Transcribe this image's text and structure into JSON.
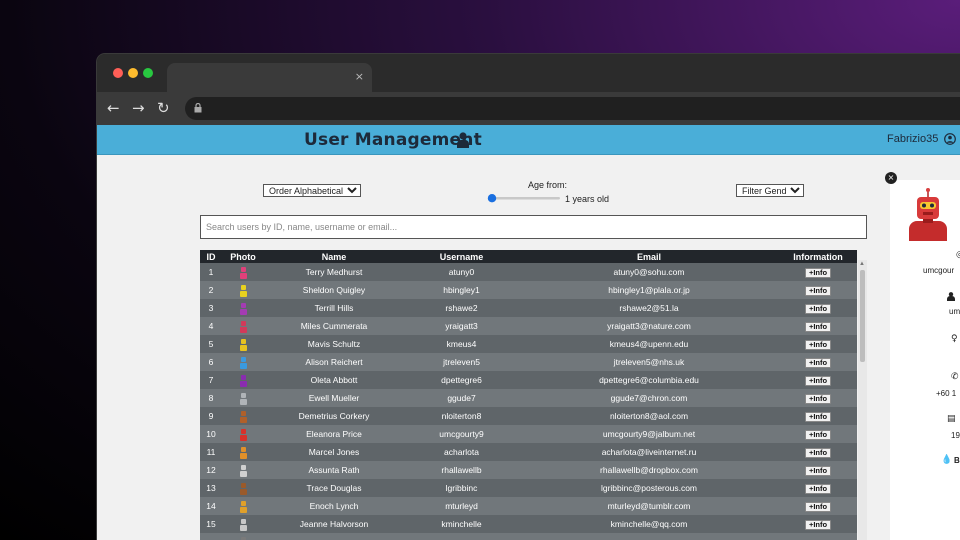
{
  "browser": {
    "tab_close": "×",
    "nav": {
      "back": "←",
      "forward": "→",
      "reload": "↻"
    },
    "lock": "🔒"
  },
  "header": {
    "title": "User Management",
    "title_icon": "person-icon",
    "user": "Fabrizio35",
    "user_icon": "user-circle-icon"
  },
  "controls": {
    "sort_value": "Order Alphabetically",
    "age_label": "Age from:",
    "age_value": "1 years old",
    "age_min": 1,
    "gender_value": "Filter Gender",
    "search_placeholder": "Search users by ID, name, username or email..."
  },
  "table": {
    "headers": {
      "id": "ID",
      "photo": "Photo",
      "name": "Name",
      "username": "Username",
      "email": "Email",
      "info": "Information"
    },
    "info_label": "+Info",
    "rows": [
      {
        "id": "1",
        "name": "Terry Medhurst",
        "username": "atuny0",
        "email": "atuny0@sohu.com",
        "color": "#e0407a"
      },
      {
        "id": "2",
        "name": "Sheldon Quigley",
        "username": "hbingley1",
        "email": "hbingley1@plala.or.jp",
        "color": "#e8d21f"
      },
      {
        "id": "3",
        "name": "Terrill Hills",
        "username": "rshawe2",
        "email": "rshawe2@51.la",
        "color": "#a43bb3"
      },
      {
        "id": "4",
        "name": "Miles Cummerata",
        "username": "yraigatt3",
        "email": "yraigatt3@nature.com",
        "color": "#d23a5a"
      },
      {
        "id": "5",
        "name": "Mavis Schultz",
        "username": "kmeus4",
        "email": "kmeus4@upenn.edu",
        "color": "#e8c21f"
      },
      {
        "id": "6",
        "name": "Alison Reichert",
        "username": "jtreleven5",
        "email": "jtreleven5@nhs.uk",
        "color": "#3a9ae0"
      },
      {
        "id": "7",
        "name": "Oleta Abbott",
        "username": "dpettegre6",
        "email": "dpettegre6@columbia.edu",
        "color": "#8a2cb0"
      },
      {
        "id": "8",
        "name": "Ewell Mueller",
        "username": "ggude7",
        "email": "ggude7@chron.com",
        "color": "#b0b4b8"
      },
      {
        "id": "9",
        "name": "Demetrius Corkery",
        "username": "nloiterton8",
        "email": "nloiterton8@aol.com",
        "color": "#b0602a"
      },
      {
        "id": "10",
        "name": "Eleanora Price",
        "username": "umcgourty9",
        "email": "umcgourty9@jalbum.net",
        "color": "#d8302a"
      },
      {
        "id": "11",
        "name": "Marcel Jones",
        "username": "acharlota",
        "email": "acharlota@liveinternet.ru",
        "color": "#e0902a"
      },
      {
        "id": "12",
        "name": "Assunta Rath",
        "username": "rhallawellb",
        "email": "rhallawellb@dropbox.com",
        "color": "#d0d0d0"
      },
      {
        "id": "13",
        "name": "Trace Douglas",
        "username": "lgribbinc",
        "email": "lgribbinc@posterous.com",
        "color": "#9a5a2a"
      },
      {
        "id": "14",
        "name": "Enoch Lynch",
        "username": "mturleyd",
        "email": "mturleyd@tumblr.com",
        "color": "#e0a02a"
      },
      {
        "id": "15",
        "name": "Jeanne Halvorson",
        "username": "kminchelle",
        "email": "kminchelle@qq.com",
        "color": "#c8c8c8"
      },
      {
        "id": "",
        "name": "",
        "username": "",
        "email": "",
        "color": "#7a7a7a"
      }
    ]
  },
  "detail": {
    "close": "×",
    "username": "umcgour",
    "name": "um",
    "phone": "+60 1",
    "age": "19",
    "blood": "B",
    "icons": [
      "user-id-icon",
      "person-icon",
      "gender-icon",
      "phone-icon",
      "birthday-icon",
      "blood-drop-icon"
    ]
  }
}
